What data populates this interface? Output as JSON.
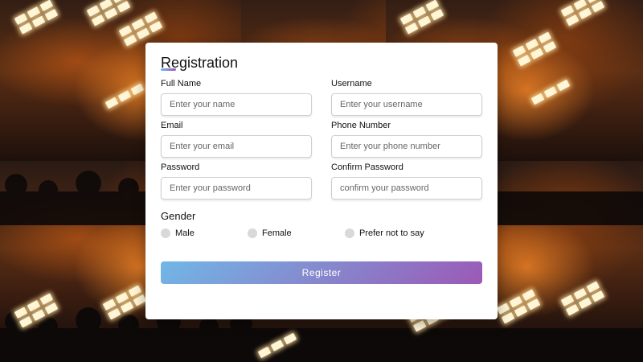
{
  "form": {
    "title": "Registration",
    "fields": [
      {
        "label": "Full Name",
        "placeholder": "Enter your name"
      },
      {
        "label": "Username",
        "placeholder": "Enter your username"
      },
      {
        "label": "Email",
        "placeholder": "Enter your email"
      },
      {
        "label": "Phone Number",
        "placeholder": "Enter your phone number"
      },
      {
        "label": "Password",
        "placeholder": "Enter your password"
      },
      {
        "label": "Confirm Password",
        "placeholder": "confirm your password"
      }
    ],
    "gender": {
      "title": "Gender",
      "options": [
        "Male",
        "Female",
        "Prefer not to say"
      ]
    },
    "submit_label": "Register"
  },
  "theme": {
    "accent_start": "#71b7e6",
    "accent_end": "#9b59b6"
  }
}
